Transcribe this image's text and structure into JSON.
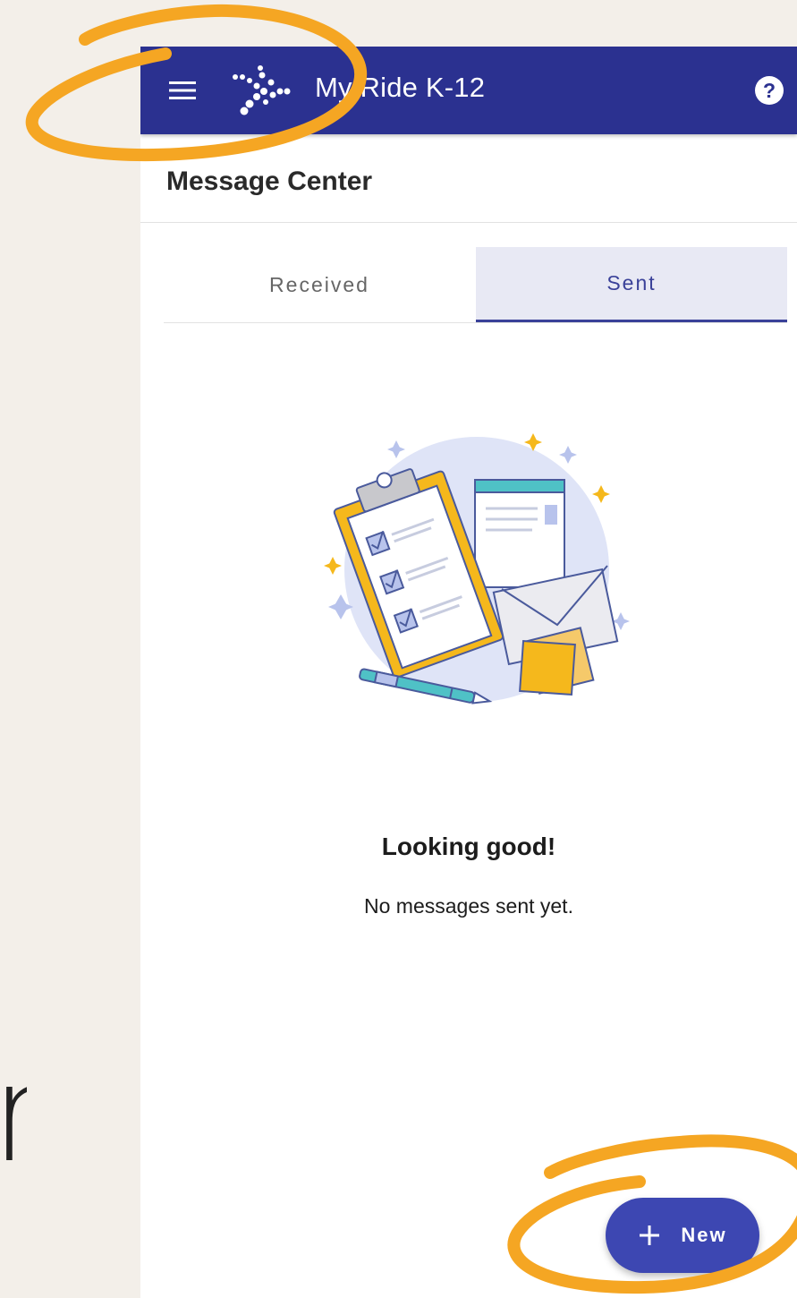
{
  "app": {
    "title": "My Ride K-12"
  },
  "page": {
    "title": "Message Center"
  },
  "tabs": [
    {
      "label": "Received",
      "active": false
    },
    {
      "label": "Sent",
      "active": true
    }
  ],
  "empty_state": {
    "title": "Looking good!",
    "subtitle": "No messages sent yet."
  },
  "fab": {
    "label": "New"
  },
  "background_text": "r",
  "colors": {
    "app_bar": "#2b3190",
    "accent": "#3a4199",
    "fab": "#3d47b2",
    "annotation": "#f5a623",
    "background": "#f3efe9"
  },
  "icons": {
    "menu": "menu-icon",
    "logo": "logo-icon",
    "help": "help-icon",
    "plus": "plus-icon",
    "illustration": "clipboard-envelope-illustration"
  }
}
